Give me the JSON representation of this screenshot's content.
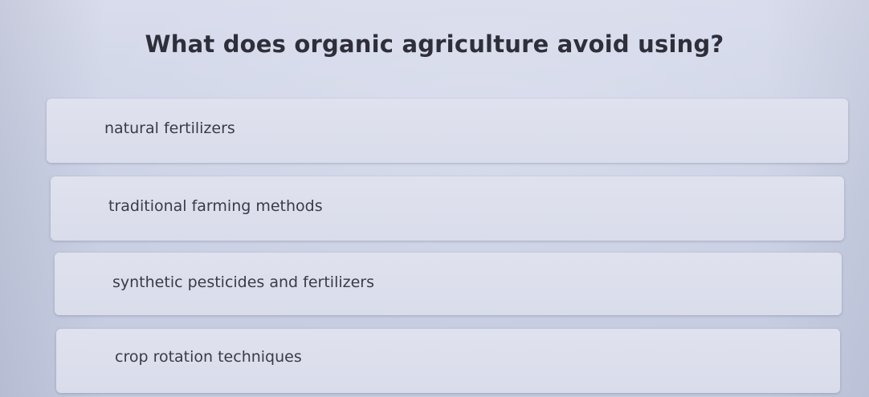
{
  "quiz": {
    "question": "What does organic agriculture avoid using?",
    "options": [
      {
        "label": "natural fertilizers"
      },
      {
        "label": "traditional farming methods"
      },
      {
        "label": "synthetic pesticides and fertilizers"
      },
      {
        "label": "crop rotation techniques"
      }
    ]
  }
}
